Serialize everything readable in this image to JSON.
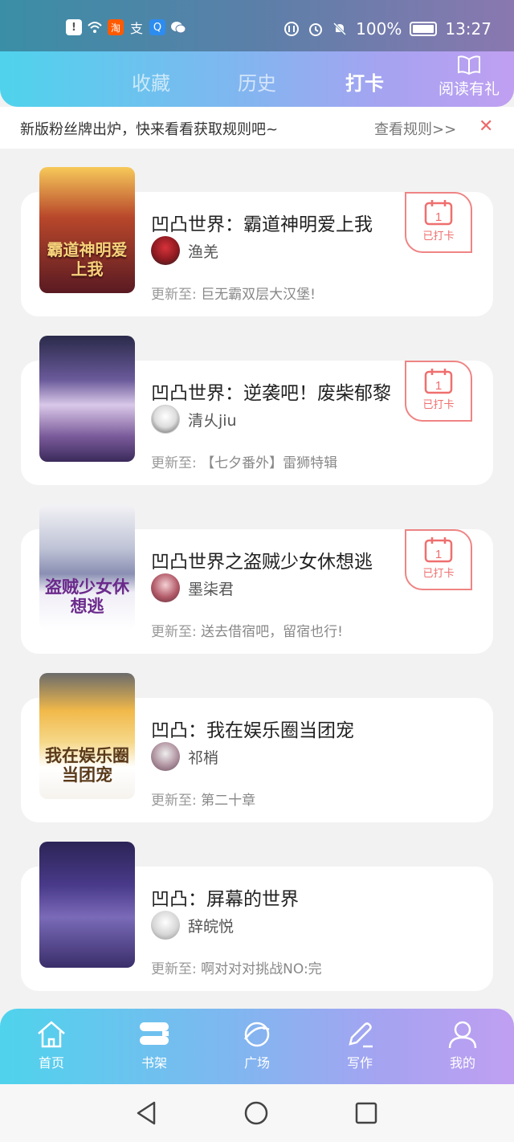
{
  "status_bar": {
    "battery": "100%",
    "time": "13:27",
    "left_icons": [
      "notification-icon",
      "wifi-icon",
      "taobao-icon",
      "alipay-icon",
      "qq-browser-icon",
      "wechat-icon"
    ]
  },
  "tabs": [
    {
      "label": "收藏",
      "active": false
    },
    {
      "label": "历史",
      "active": false
    },
    {
      "label": "打卡",
      "active": true
    }
  ],
  "reward": {
    "label": "阅读有礼"
  },
  "notice": {
    "text": "新版粉丝牌出炉，快来看看获取规则吧~",
    "link": "查看规则>>",
    "close": "✕"
  },
  "update_prefix": "更新至:",
  "checkin_label": "已打卡",
  "checkin_day": "1",
  "books": [
    {
      "title": "凹凸世界：霸道神明爱上我",
      "author": "渔羌",
      "update": "巨无霸双层大汉堡!",
      "checked_in": true,
      "cover_text": "霸道神明爱上我"
    },
    {
      "title": "凹凸世界：逆袭吧！废柴郁黎",
      "author": "清乆jiu",
      "update": "【七夕番外】雷狮特辑",
      "checked_in": true,
      "cover_text": ""
    },
    {
      "title": "凹凸世界之盗贼少女休想逃",
      "author": "墨柒君",
      "update": "送去借宿吧，留宿也行!",
      "checked_in": true,
      "cover_text": "盗贼少女休想逃"
    },
    {
      "title": "凹凸：我在娱乐圈当团宠",
      "author": "祁梢",
      "update": "第二十章",
      "checked_in": false,
      "cover_text": "我在娱乐圈当团宠"
    },
    {
      "title": "凹凸：屏幕的世界",
      "author": "辞皖悦",
      "update": "啊对对对挑战NO:完",
      "checked_in": false,
      "cover_text": ""
    }
  ],
  "bottom_nav": [
    {
      "label": "首页",
      "icon": "home-icon",
      "active": false
    },
    {
      "label": "书架",
      "icon": "bookshelf-icon",
      "active": true
    },
    {
      "label": "广场",
      "icon": "planet-icon",
      "active": false
    },
    {
      "label": "写作",
      "icon": "pen-icon",
      "active": false
    },
    {
      "label": "我的",
      "icon": "profile-icon",
      "active": false
    }
  ],
  "system_nav": [
    "back-icon",
    "home-circle-icon",
    "recents-icon"
  ]
}
